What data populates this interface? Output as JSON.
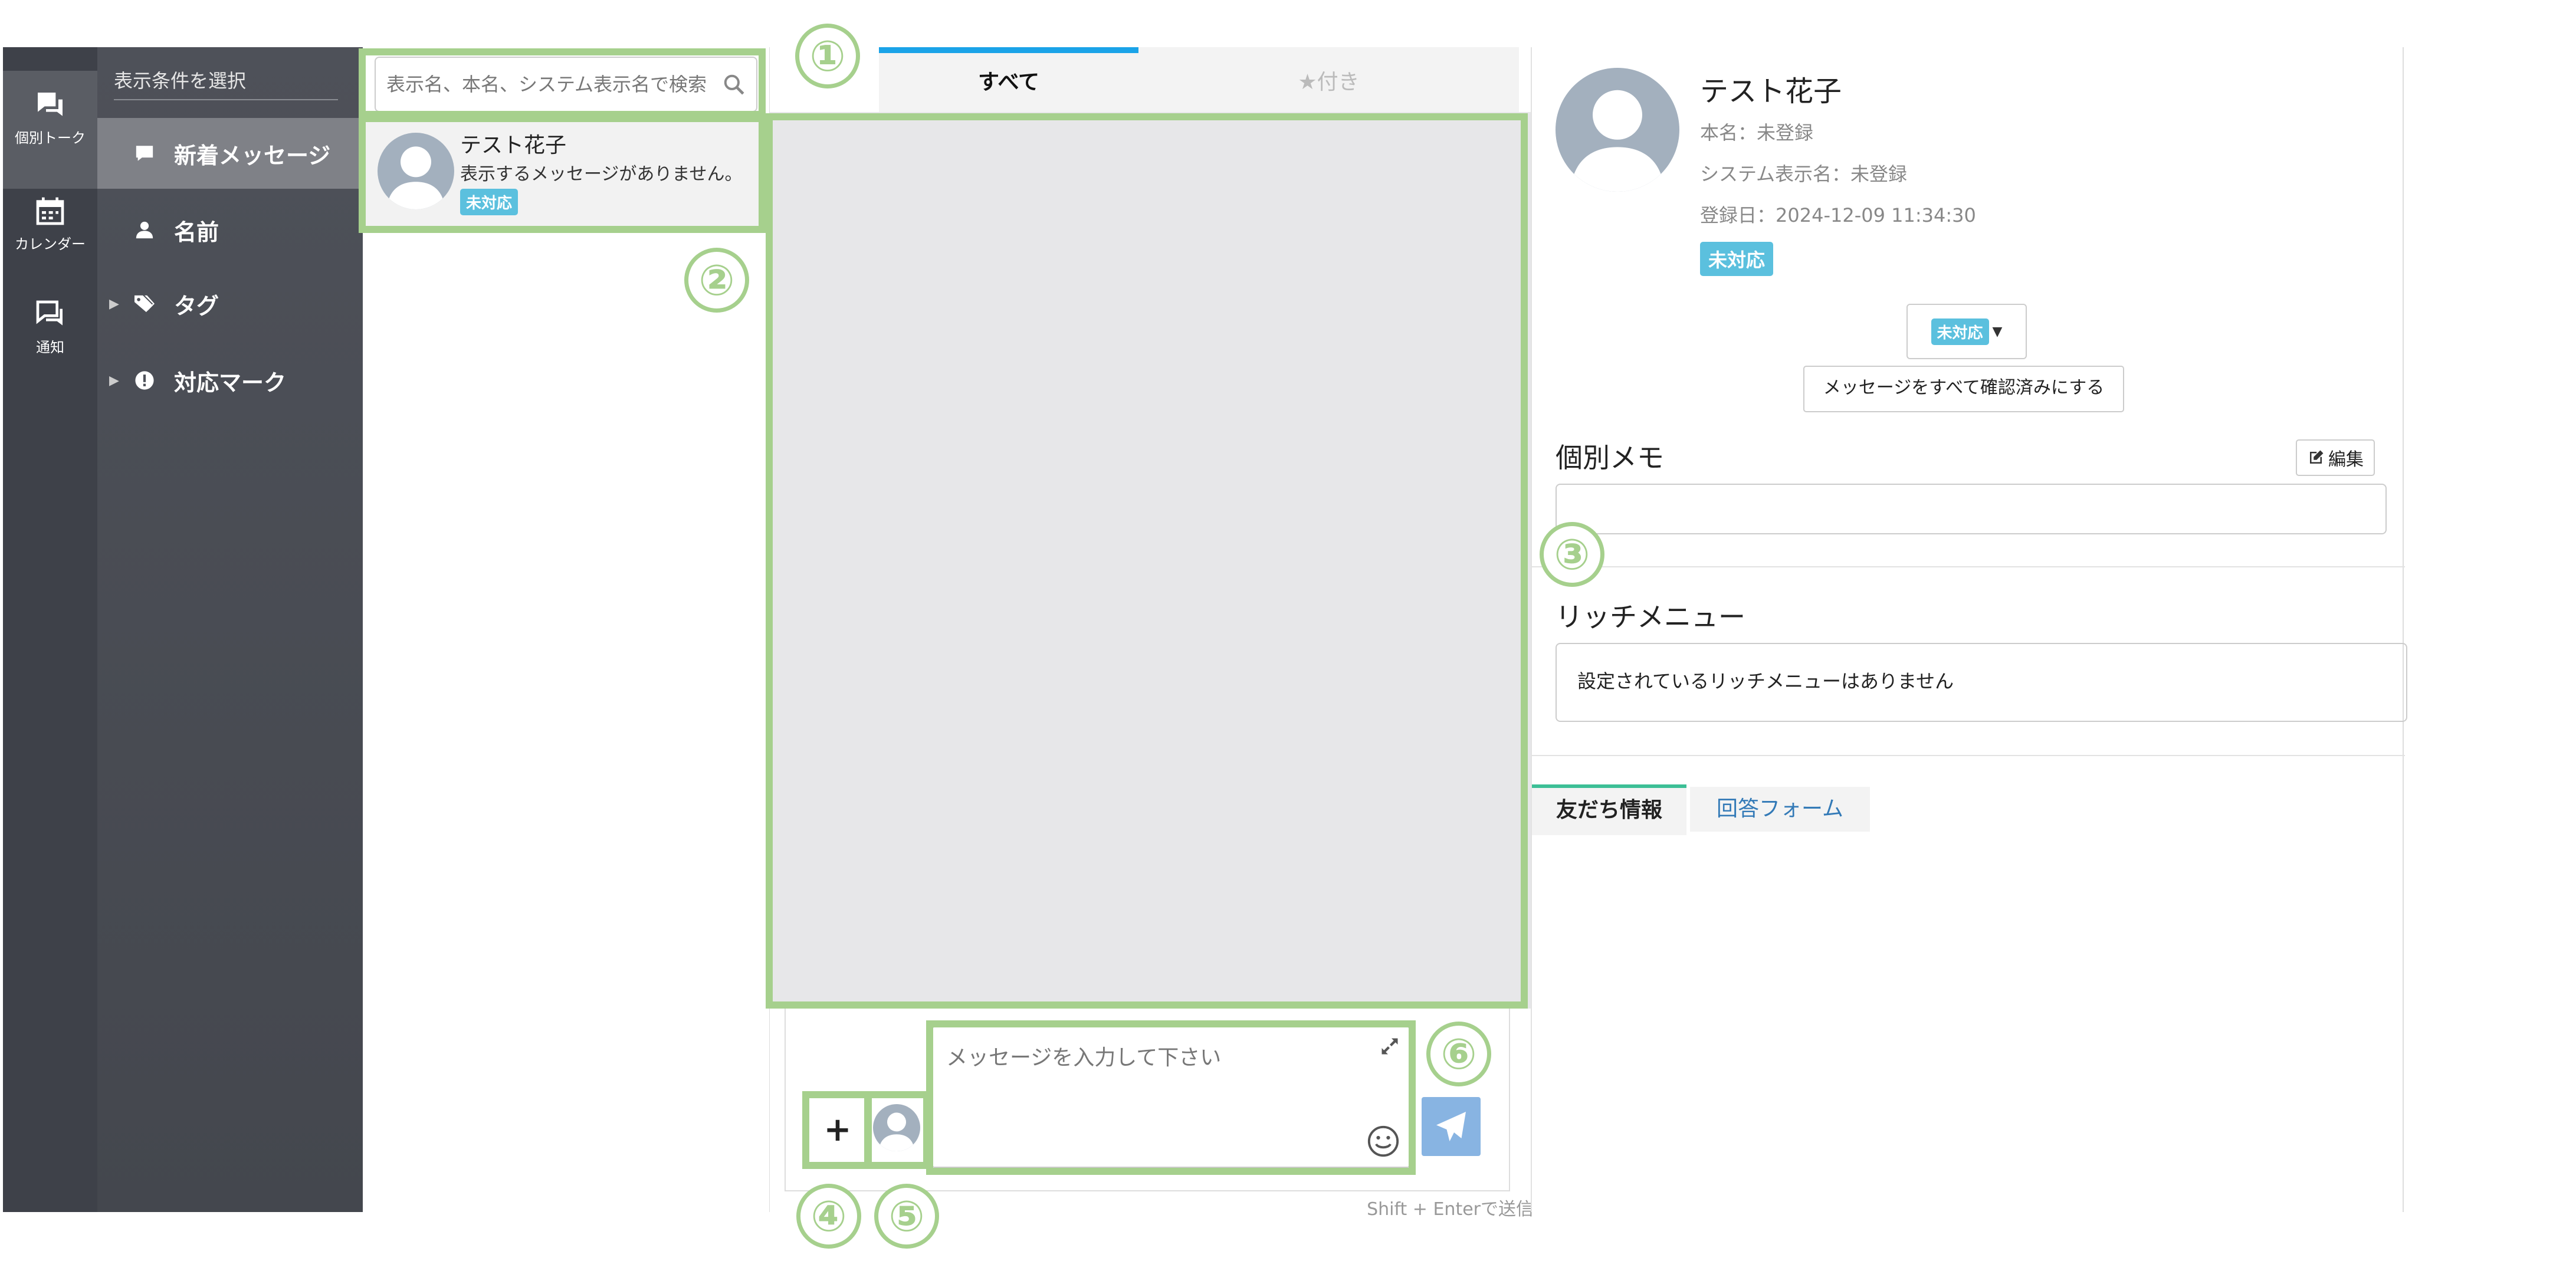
{
  "rail": {
    "items": [
      {
        "label": "個別トーク",
        "icon": "chat-bubbles-icon"
      },
      {
        "label": "カレンダー",
        "icon": "calendar-icon"
      },
      {
        "label": "通知",
        "icon": "notice-chat-icon"
      }
    ]
  },
  "filter": {
    "title": "表示条件を選択",
    "items": [
      {
        "label": "新着メッセージ",
        "icon": "message-icon"
      },
      {
        "label": "名前",
        "icon": "person-icon"
      },
      {
        "label": "タグ",
        "icon": "tags-icon"
      },
      {
        "label": "対応マーク",
        "icon": "exclamation-circle-icon"
      }
    ]
  },
  "list": {
    "search_placeholder": "表示名、本名、システム表示名で検索",
    "contacts": [
      {
        "name": "テスト花子",
        "message": "表示するメッセージがありません。",
        "badge": "未対応"
      }
    ]
  },
  "messages": {
    "tabs": [
      {
        "label": "すべて",
        "active": true
      },
      {
        "label": "★付き",
        "active": false
      }
    ],
    "composer": {
      "add_label": "+",
      "placeholder": "メッセージを入力して下さい",
      "send_hint": "Shift + Enterで送信"
    }
  },
  "profile": {
    "name": "テスト花子",
    "real_name": "本名：未登録",
    "system_name": "システム表示名：未登録",
    "registered": "登録日：2024-12-09 11:34:30",
    "badge": "未対応",
    "status_value": "未対応",
    "mark_read_label": "メッセージをすべて確認済みにする",
    "memo_title": "個別メモ",
    "memo_edit_label": "編集",
    "rich_title": "リッチメニュー",
    "rich_text": "設定されているリッチメニューはありません",
    "tabs": [
      "友だち情報",
      "回答フォーム"
    ]
  },
  "colors": {
    "rail_bg": "#3e4149",
    "filter_bg": "#4e5159",
    "active_tab_line": "#1aa3e8",
    "badge": "#5bc0de",
    "send_button": "#88b4e2",
    "annotation": "#a6d08d",
    "friend_tab_line": "#3cbf96"
  },
  "annotations": [
    "①",
    "②",
    "③",
    "④",
    "⑤",
    "⑥"
  ]
}
